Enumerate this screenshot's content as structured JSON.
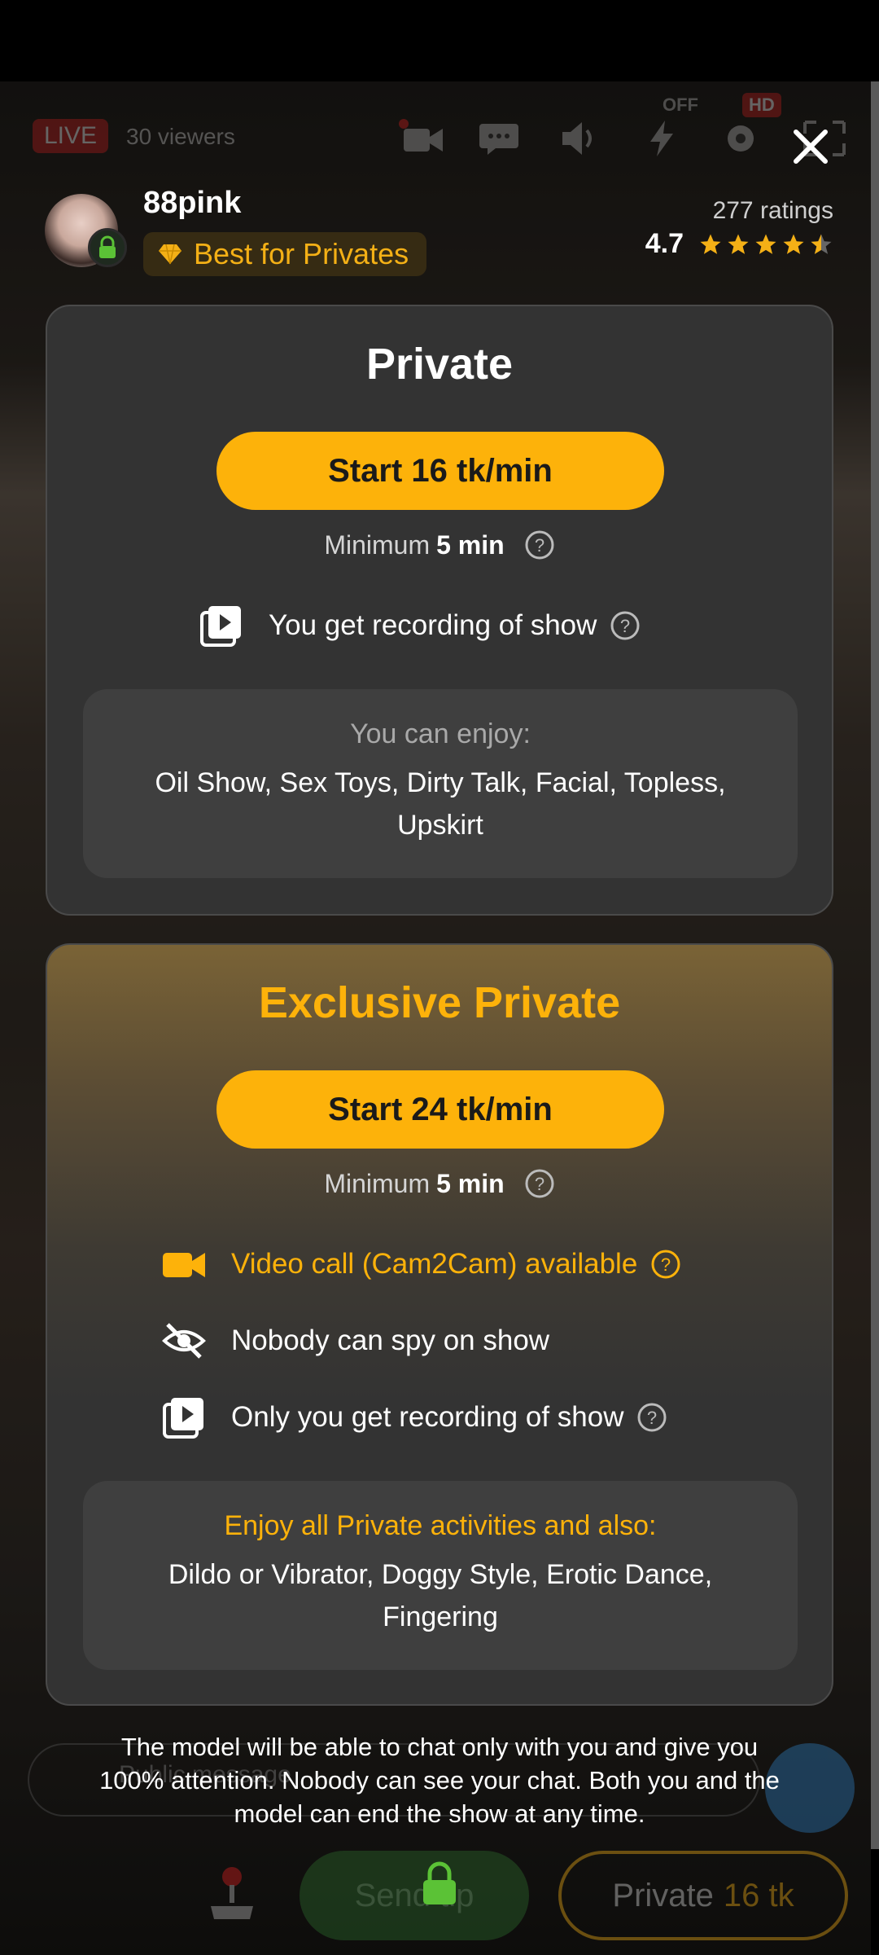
{
  "top_bar": {
    "live_label": "LIVE",
    "viewers": "30 viewers",
    "off_label": "OFF",
    "hd_label": "HD"
  },
  "model": {
    "name": "88pink",
    "badge": "Best for Privates",
    "ratings_count": "277 ratings",
    "rating_value": "4.7",
    "stars": 4.5
  },
  "private_card": {
    "title": "Private",
    "start_button": "Start 16 tk/min",
    "minimum_prefix": "Minimum",
    "minimum_value": "5 min",
    "recording_text": "You get recording of show",
    "enjoy_title": "You can enjoy:",
    "enjoy_list_line1": "Oil Show, Sex Toys, Dirty Talk, Facial, Topless,",
    "enjoy_list_line2": "Upskirt"
  },
  "exclusive_card": {
    "title": "Exclusive Private",
    "start_button": "Start 24 tk/min",
    "minimum_prefix": "Minimum",
    "minimum_value": "5 min",
    "feature_cam": "Video call (Cam2Cam) available",
    "feature_spy": "Nobody can spy on show",
    "feature_recording": "Only you get recording of show",
    "enjoy_title": "Enjoy all Private activities and also:",
    "enjoy_list_line1": "Dildo or Vibrator, Doggy Style, Erotic Dance,",
    "enjoy_list_line2": "Fingering"
  },
  "footer": {
    "note_line1": "The model will be able to chat only with you and give you",
    "note_line2": "100% attention. Nobody can see your chat. Both you and the",
    "note_line3": "model can end the show at any time."
  },
  "bottom_bar": {
    "chat_placeholder": "Public message",
    "send_tip": "Send tip",
    "private_label": "Private",
    "private_price": "16 tk"
  },
  "colors": {
    "accent": "#fdb20a",
    "live_red": "#c21d1d",
    "card_bg": "#333333"
  }
}
